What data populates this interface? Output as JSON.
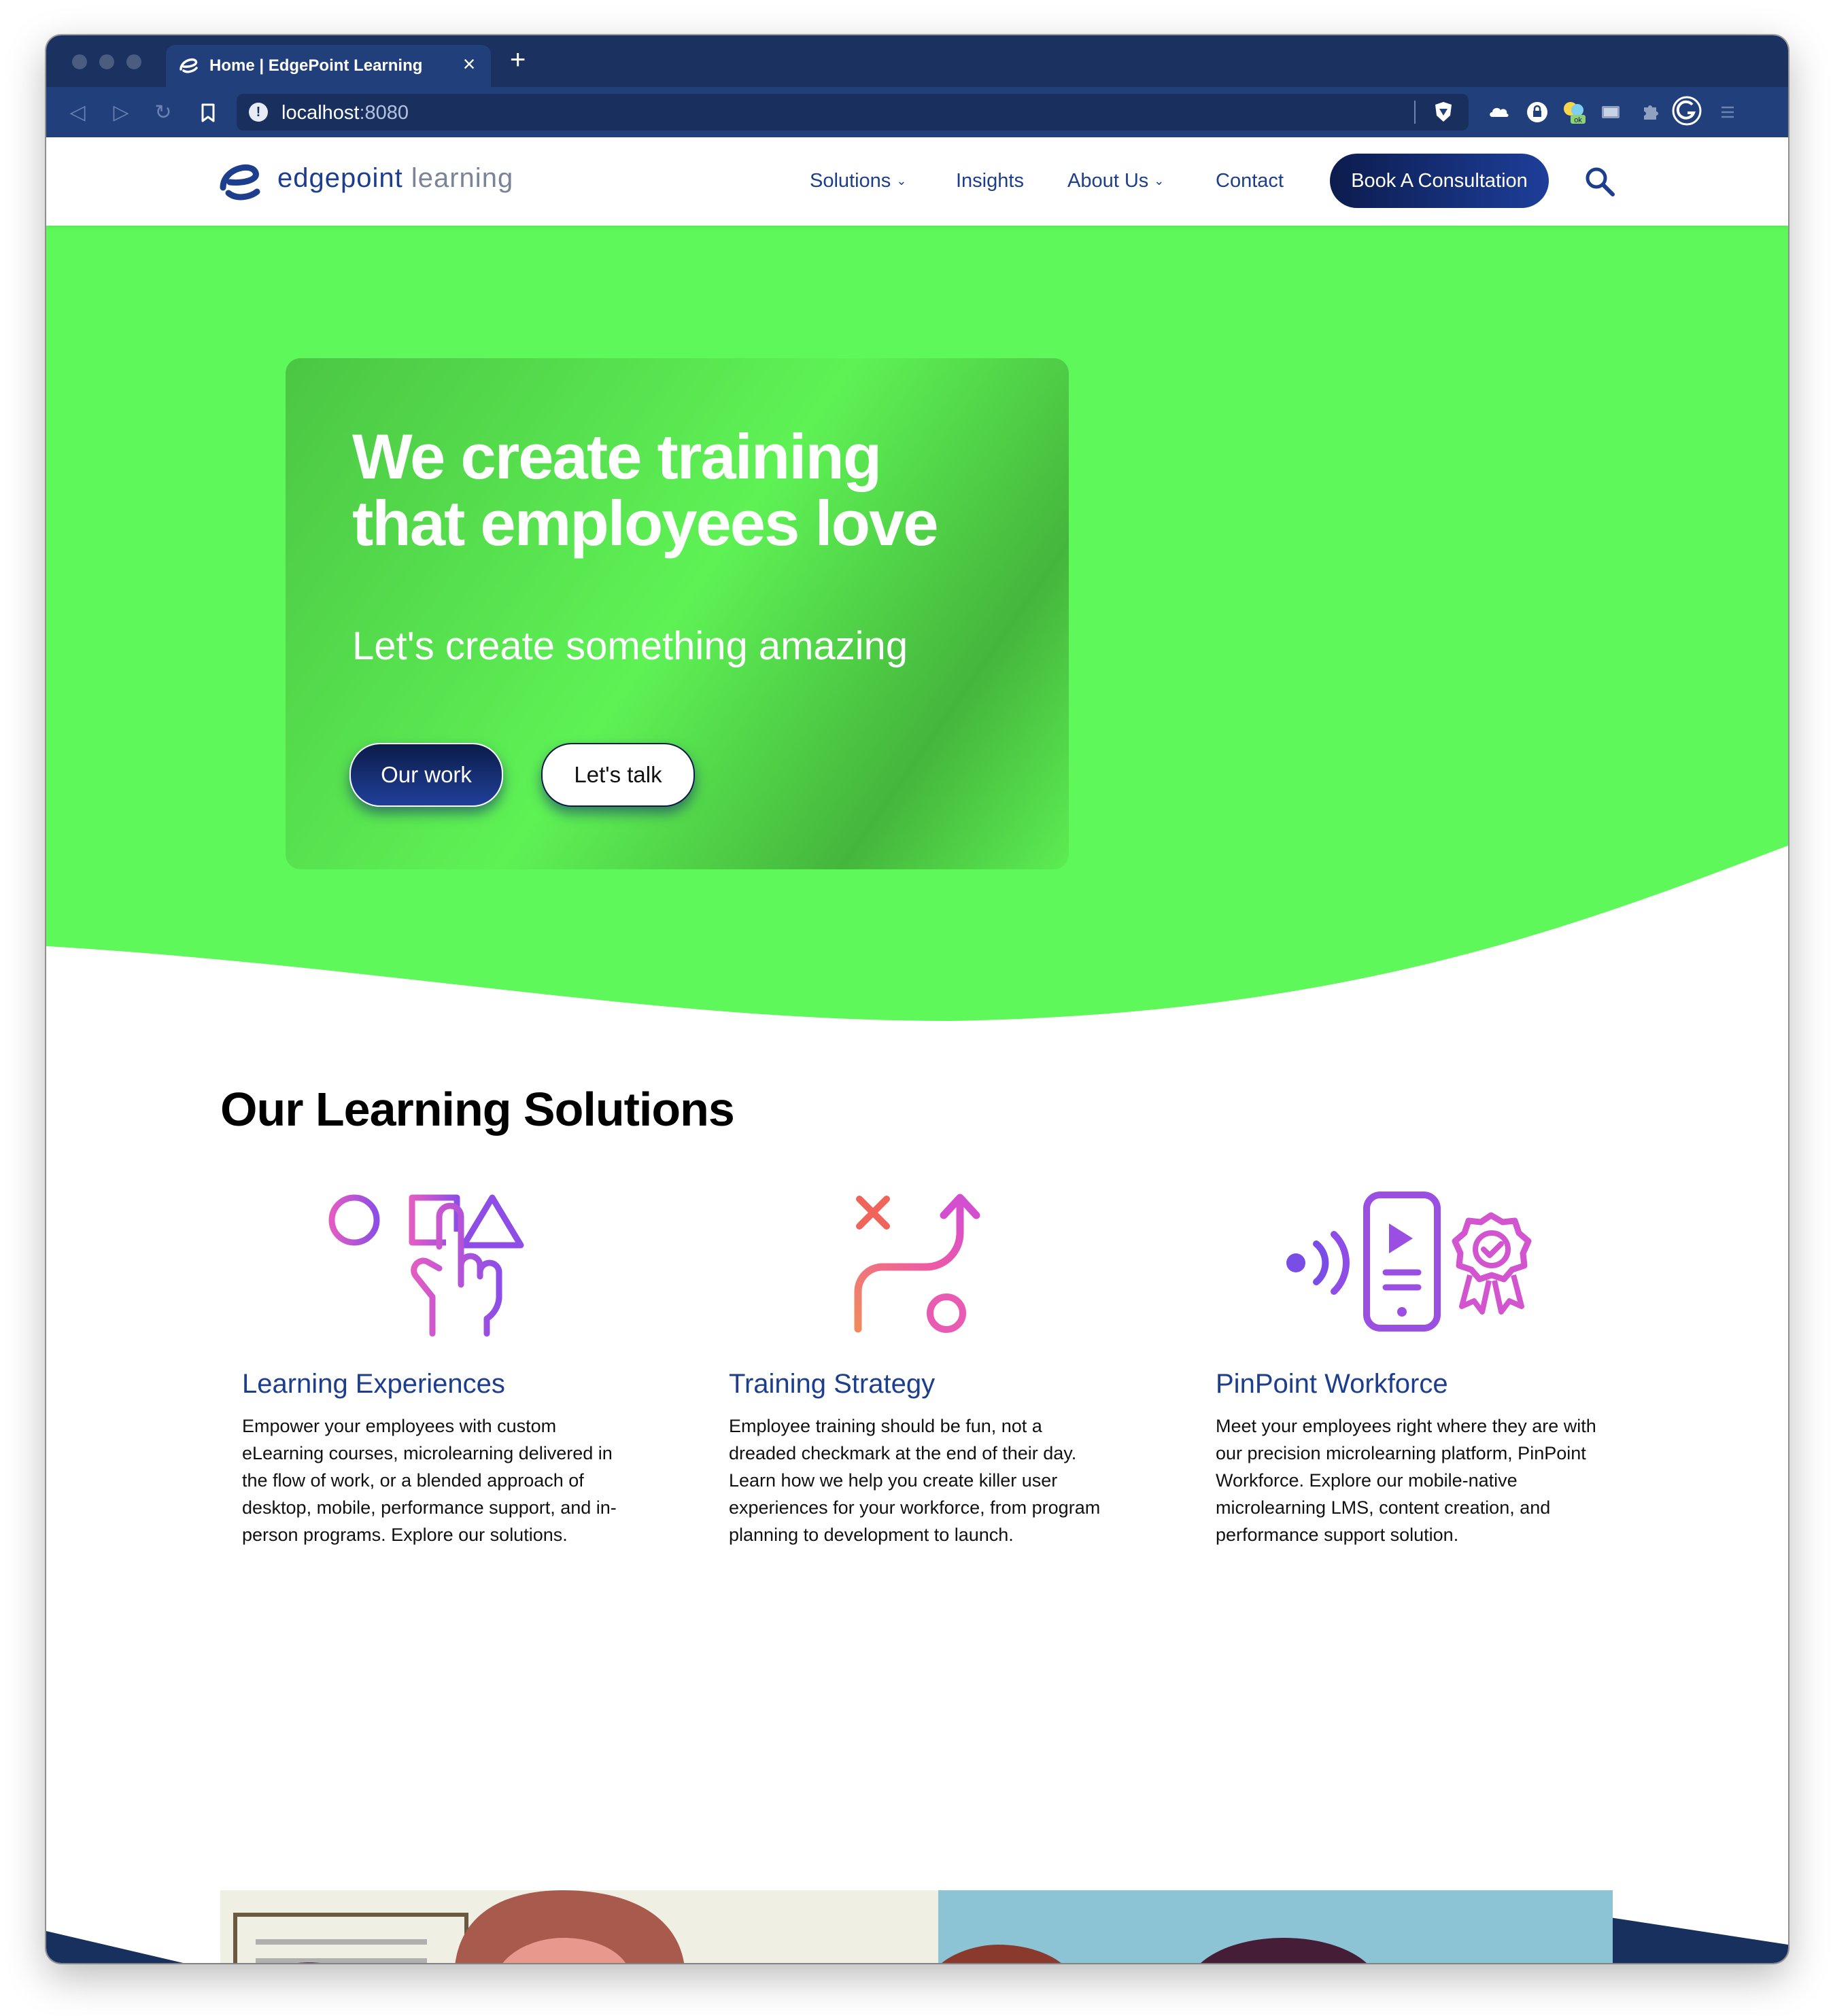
{
  "browser": {
    "tab_title": "Home | EdgePoint Learning",
    "tab_close": "×",
    "new_tab": "+",
    "url_host": "localhost",
    "url_port": ":8080",
    "ext_badge": "ok"
  },
  "nav": {
    "logo_main": "edgepoint",
    "logo_light": "learning",
    "links": [
      "Solutions",
      "Insights",
      "About Us",
      "Contact"
    ],
    "cta": "Book A Consultation"
  },
  "hero": {
    "title_line1": "We create training",
    "title_line2": "that employees love",
    "subtitle": "Let's create something amazing",
    "btn_primary": "Our work",
    "btn_secondary": "Let's talk",
    "background_color": "#5ef85a"
  },
  "solutions": {
    "heading": "Our Learning Solutions",
    "cards": [
      {
        "icon": "shapes-hand-icon",
        "title": "Learning Experiences",
        "body": "Empower your employees with custom eLearning courses, microlearning delivered in the flow of work, or a blended approach of desktop, mobile, performance support, and in-person programs. Explore our solutions."
      },
      {
        "icon": "strategy-path-icon",
        "title": "Training Strategy",
        "body": "Employee training should be fun, not a dreaded checkmark at the end of their day. Learn how we help you create killer user experiences for your workforce, from program planning to development to launch."
      },
      {
        "icon": "mobile-award-icon",
        "title": "PinPoint Workforce",
        "body": "Meet your employees right where they are with our precision microlearning platform, PinPoint Workforce. Explore our mobile-native microlearning LMS, content creation, and performance support solution."
      }
    ]
  },
  "colors": {
    "brand_blue": "#1d3e8c",
    "hero_green": "#5ef85a",
    "chrome_dark": "#1b3260"
  }
}
